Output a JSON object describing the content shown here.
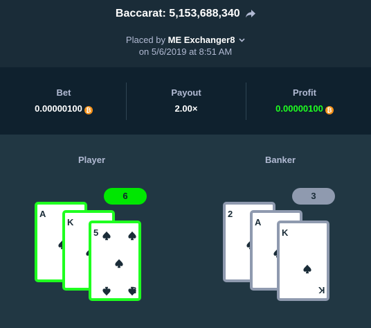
{
  "header": {
    "title": "Baccarat: 5,153,688,340",
    "placed_prefix": "Placed by",
    "username": "ME Exchanger8",
    "date": "on 5/6/2019 at 8:51 AM"
  },
  "stats": {
    "bet_label": "Bet",
    "bet_value": "0.00000100",
    "payout_label": "Payout",
    "payout_value": "2.00×",
    "profit_label": "Profit",
    "profit_value": "0.00000100",
    "currency_icon": "bitcoin-icon"
  },
  "player": {
    "label": "Player",
    "score": "6",
    "cards": [
      {
        "rank": "A",
        "suit": "spade"
      },
      {
        "rank": "K",
        "suit": "spade"
      },
      {
        "rank": "5",
        "suit": "spade"
      }
    ]
  },
  "banker": {
    "label": "Banker",
    "score": "3",
    "cards": [
      {
        "rank": "2",
        "suit": "spade"
      },
      {
        "rank": "A",
        "suit": "spade"
      },
      {
        "rank": "K",
        "suit": "spade"
      }
    ]
  },
  "colors": {
    "background": "#213743",
    "header": "#1a2c38",
    "stats_band": "#0f212e",
    "win": "#1fff20",
    "lose": "#8f9aaf",
    "coin": "#f7931a"
  }
}
